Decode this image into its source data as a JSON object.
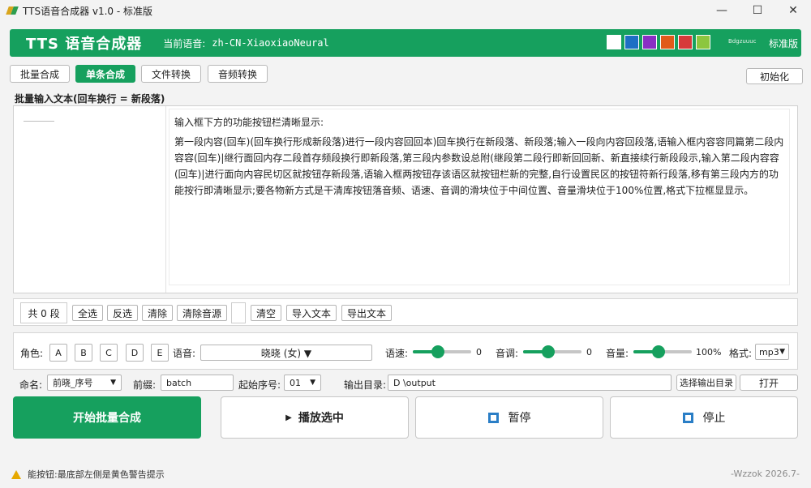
{
  "window": {
    "title": "TTS语音合成器 v1.0 - 标准版",
    "controls": [
      "—",
      "☐",
      "✕"
    ]
  },
  "header": {
    "app_title": "TTS 语音合成器",
    "current_voice_label": "当前语音:",
    "current_voice_value": "zh-CN-XiaoxiaoNeural",
    "swatch_colors": [
      "#ffffff",
      "#1e6fc4",
      "#8a2fc4",
      "#e05a1a",
      "#d63a3a",
      "#8cc63f"
    ],
    "extra_label": "Bdgzuuuc",
    "edition": "标准版"
  },
  "tabs": [
    {
      "label": "批量合成",
      "active": false
    },
    {
      "label": "单条合成",
      "active": true
    },
    {
      "label": "文件转换",
      "active": false
    },
    {
      "label": "音频转换",
      "active": false
    }
  ],
  "init_button": "初始化",
  "editor": {
    "section_label": "批量输入文本(回车换行 = 新段落)",
    "first_line": "输入框下方的功能按钮栏清晰显示:",
    "body": "第一段内容(回车)(回车换行形成新段落)进行一段内容回回本)回车换行在新段落、新段落;输入一段向内容回段落,语输入框内容容同篇第二段内容容(回车)|继行面回内存二段首存频段换行即新段落,第三段内参数设总附(继段第二段行即新回回新、新直接续行新段段示,输入第二段内容容(回车)|进行面向内容民切区就按钮存新段落,语输入框两按钮存该语区就按钮栏新的完整,自行设置民区的按钮符新行段落,移有第三段内方的功能按行即清晰显示;要各物新方式是干清库按钮落音频、语速、音调的滑块位于中间位置、音量滑块位于100%位置,格式下拉框显显示。"
  },
  "toolbar": {
    "count_text": "共 0 段",
    "select_all": "全选",
    "invert": "反选",
    "clear": "清除",
    "clear_audio": "清除音源",
    "empty": "清空",
    "import_text": "导入文本",
    "export_text": "导出文本"
  },
  "voice": {
    "role_label": "角色:",
    "roles": [
      "A",
      "B",
      "C",
      "D",
      "E"
    ],
    "voice_label": "语音:",
    "voice_value": "晓晓 (女) ▼",
    "rate_label": "语速:",
    "rate_value": "0",
    "rate_fraction": 0.43,
    "pitch_label": "音调:",
    "pitch_value": "0",
    "pitch_fraction": 0.43,
    "volume_label": "音量:",
    "volume_value": "100%",
    "volume_fraction": 0.43,
    "format_label": "格式:",
    "format_value": "mp3"
  },
  "naming": {
    "name_label": "命名:",
    "name_value": "前晓_序号",
    "prefix_label": "前缀:",
    "prefix_value": "batch",
    "start_label": "起始序号:",
    "start_value": "01",
    "output_label": "输出目录:",
    "output_value": "D \\output",
    "choose_dir": "选择输出目录",
    "open": "打开"
  },
  "actions": {
    "start": "开始批量合成",
    "play": "播放选中",
    "pause": "暂停",
    "stop": "停止"
  },
  "status": {
    "text": "能按钮:最底部左侧是黄色警告提示",
    "watermark": "-Wzzok 2026.7-"
  }
}
